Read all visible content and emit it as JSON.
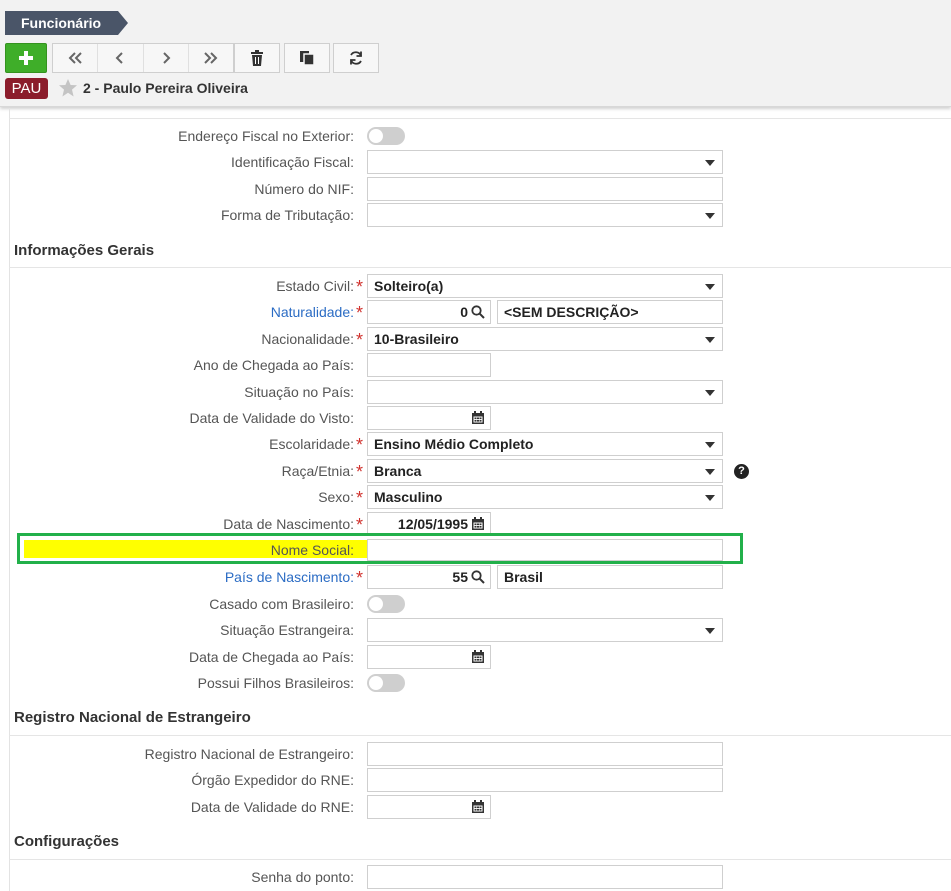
{
  "header": {
    "breadcrumb": "Funcionário",
    "badge": "PAU",
    "record_title": "2 - Paulo Pereira Oliveira"
  },
  "toolbar": {
    "add": "+",
    "buttons": [
      "first-icon",
      "previous-icon",
      "next-icon",
      "last-icon",
      "trash-icon",
      "copy-icon",
      "refresh-icon"
    ]
  },
  "fiscal": {
    "endereco_exterior": "Endereço Fiscal no Exterior:",
    "identificacao_fiscal": "Identificação Fiscal:",
    "numero_nif": "Número do NIF:",
    "forma_tributacao": "Forma de Tributação:"
  },
  "sections": {
    "gerais": "Informações Gerais",
    "rne": "Registro Nacional de Estrangeiro",
    "config": "Configurações"
  },
  "gerais": {
    "estado_civil": {
      "label": "Estado Civil:",
      "value": "Solteiro(a)"
    },
    "naturalidade": {
      "label": "Naturalidade:",
      "code": "0",
      "desc": "<SEM DESCRIÇÃO>"
    },
    "nacionalidade": {
      "label": "Nacionalidade:",
      "value": "10-Brasileiro"
    },
    "ano_chegada": {
      "label": "Ano de Chegada ao País:",
      "value": ""
    },
    "situacao_pais": {
      "label": "Situação no País:",
      "value": ""
    },
    "validade_visto": {
      "label": "Data de Validade do Visto:",
      "value": ""
    },
    "escolaridade": {
      "label": "Escolaridade:",
      "value": "Ensino Médio Completo"
    },
    "raca": {
      "label": "Raça/Etnia:",
      "value": "Branca",
      "help": "?"
    },
    "sexo": {
      "label": "Sexo:",
      "value": "Masculino"
    },
    "nascimento": {
      "label": "Data de Nascimento:",
      "value": "12/05/1995"
    },
    "nome_social": {
      "label": "Nome Social:",
      "value": ""
    },
    "pais_nascimento": {
      "label": "País de Nascimento:",
      "code": "55",
      "desc": "Brasil"
    },
    "casado_brasileiro": {
      "label": "Casado com Brasileiro:"
    },
    "situacao_estrangeira": {
      "label": "Situação Estrangeira:",
      "value": ""
    },
    "data_chegada": {
      "label": "Data de Chegada ao País:",
      "value": ""
    },
    "filhos_brasileiros": {
      "label": "Possui Filhos Brasileiros:"
    }
  },
  "rne": {
    "registro": {
      "label": "Registro Nacional de Estrangeiro:",
      "value": ""
    },
    "orgao": {
      "label": "Órgão Expedidor do RNE:",
      "value": ""
    },
    "validade": {
      "label": "Data de Validade do RNE:",
      "value": ""
    }
  },
  "config": {
    "senha_ponto": {
      "label": "Senha do ponto:",
      "value": ""
    }
  },
  "colors": {
    "breadcrumb_bg": "#4a5568",
    "add_button": "#3fae29",
    "badge_bg": "#8b1c2b",
    "link_label": "#2b6cc4",
    "required": "#d0312d",
    "highlight_border": "#22b04a",
    "highlight_fill": "#ffff00"
  }
}
